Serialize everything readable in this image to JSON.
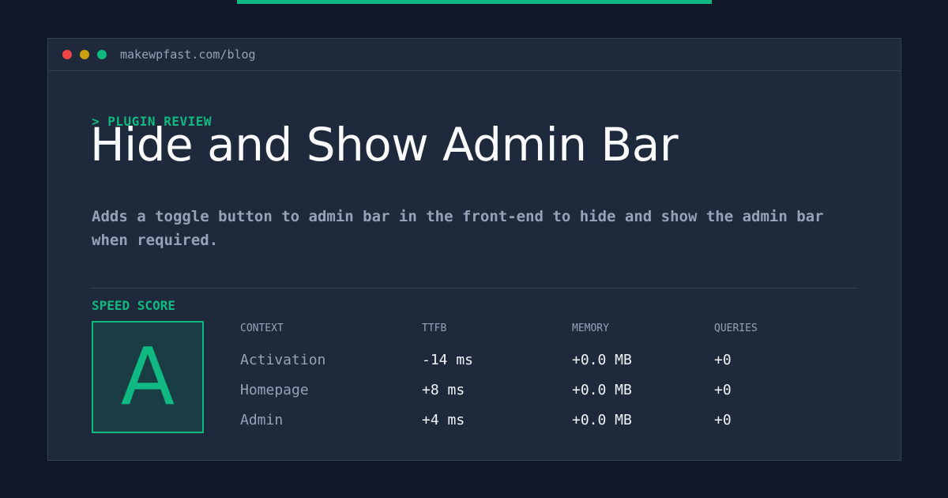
{
  "browser": {
    "url": "makewpfast.com/blog"
  },
  "header": {
    "eyebrow": "> PLUGIN REVIEW",
    "title": "Hide and Show Admin Bar",
    "description": "Adds a toggle button to admin bar in the front-end to hide and show the admin bar when required."
  },
  "speed": {
    "label": "SPEED SCORE",
    "grade": "A"
  },
  "table": {
    "columns": [
      "CONTEXT",
      "TTFB",
      "MEMORY",
      "QUERIES"
    ],
    "rows": [
      [
        "Activation",
        "-14 ms",
        "+0.0 MB",
        "+0"
      ],
      [
        "Homepage",
        "+8 ms",
        "+0.0 MB",
        "+0"
      ],
      [
        "Admin",
        "+4 ms",
        "+0.0 MB",
        "+0"
      ]
    ]
  },
  "colors": {
    "accent": "#10b981",
    "background": "#0f1729",
    "panel": "#1e293b"
  }
}
